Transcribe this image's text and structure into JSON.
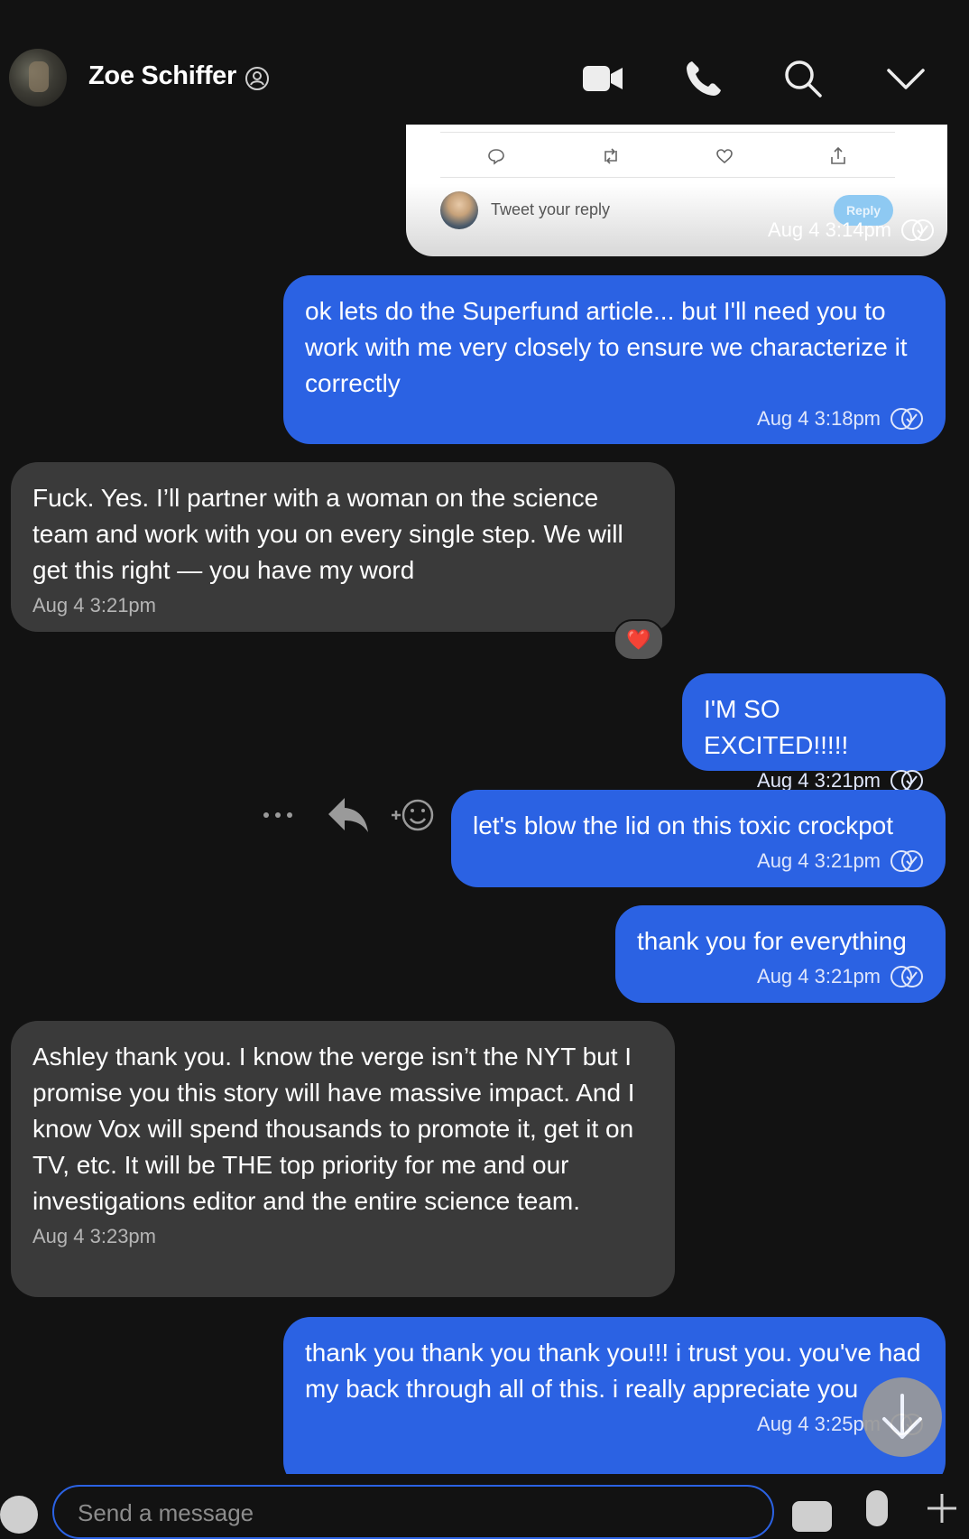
{
  "header": {
    "contact_name": "Zoe Schiffer",
    "icons": [
      "verified-icon",
      "video-call-icon",
      "phone-icon",
      "search-icon",
      "chevron-down-icon"
    ]
  },
  "tweet_card": {
    "reply_placeholder": "Tweet your reply",
    "reply_button": "Reply",
    "timestamp": "Aug 4 3:14pm"
  },
  "messages": [
    {
      "direction": "outgoing",
      "text": "ok lets do the Superfund article... but I'll need you to work with me very closely to ensure we characterize it correctly",
      "timestamp": "Aug 4 3:18pm"
    },
    {
      "direction": "incoming",
      "text": "Fuck. Yes. I’ll partner with a woman on the science team and work with you on every single step. We will get this right — you have my word",
      "timestamp": "Aug 4 3:21pm",
      "reaction": "❤️"
    },
    {
      "direction": "outgoing",
      "text": "I'M SO EXCITED!!!!!",
      "timestamp": "Aug 4 3:21pm"
    },
    {
      "direction": "outgoing",
      "text": "let's blow the lid on this toxic crockpot",
      "timestamp": "Aug 4 3:21pm"
    },
    {
      "direction": "outgoing",
      "text": "thank you for everything",
      "timestamp": "Aug 4 3:21pm"
    },
    {
      "direction": "incoming",
      "text": "Ashley thank you. I know the verge isn’t the NYT but I promise you this story will have massive impact. And I know Vox will spend thousands to promote it, get it on TV, etc. It will be THE top priority for me and our investigations editor and the entire science team.",
      "timestamp": "Aug 4 3:23pm"
    },
    {
      "direction": "outgoing",
      "text": "thank you thank you thank you!!! i trust you. you've had my back through all of this. i really appreciate you",
      "timestamp": "Aug 4 3:25pm"
    }
  ],
  "composer": {
    "placeholder": "Send a message"
  },
  "colors": {
    "background": "#121212",
    "outgoing_bubble": "#2b62e3",
    "incoming_bubble": "#3a3a3a"
  }
}
